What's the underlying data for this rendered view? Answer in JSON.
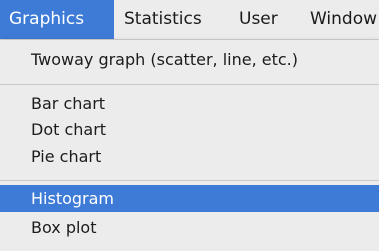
{
  "menubar": {
    "items": [
      {
        "label": "Graphics"
      },
      {
        "label": "Statistics"
      },
      {
        "label": "User"
      },
      {
        "label": "Window"
      }
    ]
  },
  "dropdown": {
    "items": [
      {
        "label": "Twoway graph (scatter, line, etc.)"
      },
      {
        "label": "Bar chart"
      },
      {
        "label": "Dot chart"
      },
      {
        "label": "Pie chart"
      },
      {
        "label": "Histogram"
      },
      {
        "label": "Box plot"
      }
    ],
    "highlighted": "Histogram"
  },
  "colors": {
    "highlight": "#3e7bd6",
    "menu_background": "#ececec",
    "text": "#1c1c1c",
    "highlight_text": "#ffffff"
  }
}
